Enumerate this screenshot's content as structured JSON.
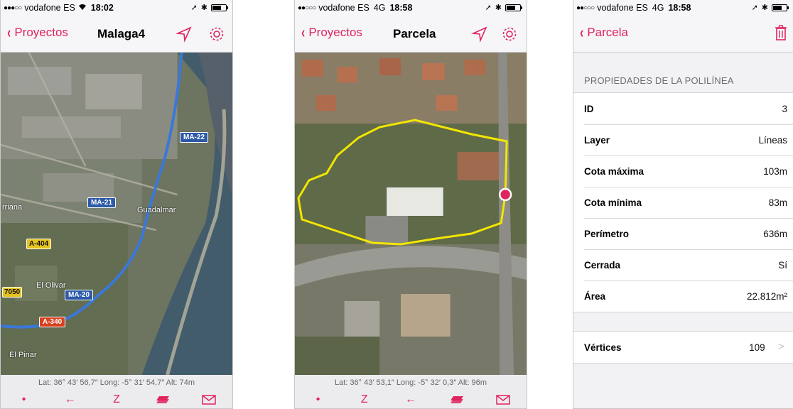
{
  "phone1": {
    "status": {
      "signal": "●●●○○",
      "carrier": "vodafone ES",
      "network": "",
      "time": "18:02"
    },
    "nav": {
      "back_label": "Proyectos",
      "title": "Malaga4"
    },
    "map_labels": {
      "road1": "MA-22",
      "road2": "MA-21",
      "road3": "A-404",
      "road4": "MA-20",
      "road5": "A-340",
      "road6": "7050",
      "town1": "Guadalmar",
      "town2": "rriana",
      "town3": "El Olivar",
      "town4": "El Pinar"
    },
    "coords": "Lat: 36° 43′ 56,7″ Long: -5° 31′ 54,7″ Alt: 74m",
    "tools": {
      "point": "•",
      "line": "←",
      "polyline": "Z"
    }
  },
  "phone2": {
    "status": {
      "signal": "●●○○○",
      "carrier": "vodafone ES",
      "network": "4G",
      "time": "18:58"
    },
    "nav": {
      "back_label": "Proyectos",
      "title": "Parcela"
    },
    "coords": "Lat: 36° 43′ 53,1″ Long: -5° 32′ 0,3″ Alt: 96m",
    "tools": {
      "point": "•",
      "polyline": "Z",
      "line": "←"
    }
  },
  "phone3": {
    "status": {
      "signal": "●●○○○",
      "carrier": "vodafone ES",
      "network": "4G",
      "time": "18:58"
    },
    "nav": {
      "back_label": "Parcela"
    },
    "section_header": "PROPIEDADES DE LA POLILÍNEA",
    "properties": [
      {
        "label": "ID",
        "value": "3"
      },
      {
        "label": "Layer",
        "value": "Líneas"
      },
      {
        "label": "Cota máxima",
        "value": "103m"
      },
      {
        "label": "Cota mínima",
        "value": "83m"
      },
      {
        "label": "Perímetro",
        "value": "636m"
      },
      {
        "label": "Cerrada",
        "value": "Sí"
      },
      {
        "label": "Área",
        "value": "22.812m²"
      }
    ],
    "vertices": {
      "label": "Vértices",
      "value": "109",
      "chevron": ">"
    }
  },
  "colors": {
    "accent": "#e0245e",
    "route": "#3a78d8",
    "polygon": "#f2e600"
  },
  "icons": [
    "chevron-left-icon",
    "location-arrow-icon",
    "gear-icon",
    "trash-icon",
    "point-icon",
    "line-icon",
    "polyline-icon",
    "layers-icon",
    "mail-icon",
    "bluetooth-icon",
    "battery-icon"
  ]
}
